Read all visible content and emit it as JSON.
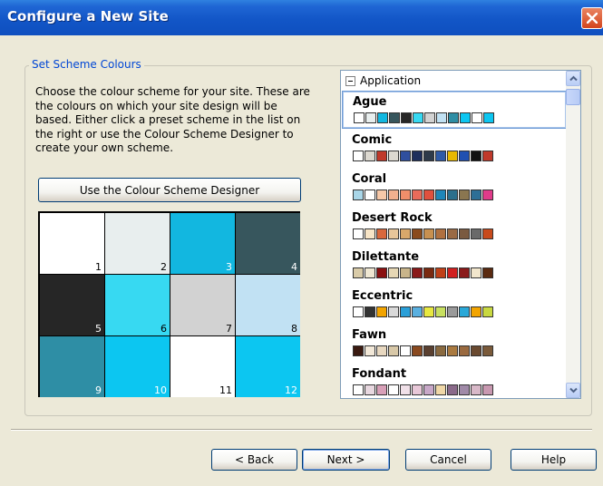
{
  "window": {
    "title": "Configure a New Site"
  },
  "group": {
    "legend": "Set Scheme Colours"
  },
  "description": "Choose the colour scheme for your site. These are the colours on which your site design will be based. Either click a preset scheme in the list on the right or use the Colour Scheme Designer to create your own scheme.",
  "designer_button": "Use the Colour Scheme Designer",
  "palette": [
    {
      "num": "1",
      "color": "#ffffff",
      "text_color": "#000000"
    },
    {
      "num": "2",
      "color": "#e8eeee",
      "text_color": "#000000"
    },
    {
      "num": "3",
      "color": "#12b7e0",
      "text_color": "#ffffff"
    },
    {
      "num": "4",
      "color": "#37565d",
      "text_color": "#ffffff"
    },
    {
      "num": "5",
      "color": "#262626",
      "text_color": "#ffffff"
    },
    {
      "num": "6",
      "color": "#37d9f2",
      "text_color": "#000000"
    },
    {
      "num": "7",
      "color": "#d2d2d2",
      "text_color": "#000000"
    },
    {
      "num": "8",
      "color": "#c1e1f3",
      "text_color": "#000000"
    },
    {
      "num": "9",
      "color": "#2e8ea5",
      "text_color": "#ffffff"
    },
    {
      "num": "10",
      "color": "#0cc6f1",
      "text_color": "#ffffff"
    },
    {
      "num": "11",
      "color": "#ffffff",
      "text_color": "#000000"
    },
    {
      "num": "12",
      "color": "#0cc6f1",
      "text_color": "#ffffff"
    }
  ],
  "list": {
    "group_label": "Application",
    "schemes": [
      {
        "name": "Ague",
        "selected": true,
        "colors": [
          "#ffffff",
          "#e8eeee",
          "#12b7e0",
          "#37565d",
          "#262626",
          "#37d9f2",
          "#d2d2d2",
          "#c1e1f3",
          "#2e8ea5",
          "#0cc6f1",
          "#ffffff",
          "#0cc6f1"
        ]
      },
      {
        "name": "Comic",
        "selected": false,
        "colors": [
          "#ffffff",
          "#dcd8d0",
          "#c0392b",
          "#dcd8d0",
          "#2f4f9e",
          "#1f2f5c",
          "#2e3a4a",
          "#2e5aa8",
          "#e8b800",
          "#2050b0",
          "#111111",
          "#c0392b"
        ]
      },
      {
        "name": "Coral",
        "selected": false,
        "colors": [
          "#a9d6e8",
          "#ffffff",
          "#f6c8a8",
          "#f3b08f",
          "#f08e6a",
          "#e96b5a",
          "#e0503e",
          "#1f86b8",
          "#2b6f8c",
          "#8a7650",
          "#2e6f96",
          "#e03b8a"
        ]
      },
      {
        "name": "Desert Rock",
        "selected": false,
        "colors": [
          "#ffffff",
          "#f7e4c6",
          "#d9683c",
          "#e8c69a",
          "#d8a86a",
          "#8a4a1c",
          "#c89050",
          "#b07040",
          "#9a6a44",
          "#7a5a40",
          "#6a6a6a",
          "#c84a1c"
        ]
      },
      {
        "name": "Dilettante",
        "selected": false,
        "colors": [
          "#d9cba8",
          "#efe7d2",
          "#8a1010",
          "#e6d7b4",
          "#c8b48a",
          "#8a1a1a",
          "#7a2a10",
          "#c04018",
          "#d02020",
          "#8a1a1a",
          "#f2e6cc",
          "#5a2a10"
        ]
      },
      {
        "name": "Eccentric",
        "selected": false,
        "colors": [
          "#ffffff",
          "#333333",
          "#f2a400",
          "#d9d9d9",
          "#2a9fd8",
          "#5ab0e0",
          "#e8e840",
          "#c8e060",
          "#9a9a9a",
          "#2aa8d8",
          "#f2a400",
          "#c8d840"
        ]
      },
      {
        "name": "Fawn",
        "selected": false,
        "colors": [
          "#3a1a10",
          "#f2e8d8",
          "#e8d8c0",
          "#d8c8a8",
          "#ffffff",
          "#8a4a20",
          "#5a4030",
          "#8a6a40",
          "#aa7a40",
          "#9a6a40",
          "#6a4a30",
          "#7a5a3a"
        ]
      },
      {
        "name": "Fondant",
        "selected": false,
        "colors": [
          "#ffffff",
          "#e8d8e0",
          "#d8a0b8",
          "#ffffff",
          "#f0e0e8",
          "#e8c8d8",
          "#c8a8c8",
          "#f0d8a8",
          "#8a6a8a",
          "#a08aa8",
          "#d8b8c8",
          "#c898b0"
        ]
      }
    ]
  },
  "buttons": {
    "back": "< Back",
    "next": "Next >",
    "cancel": "Cancel",
    "help": "Help"
  },
  "icons": {
    "close": "close-icon",
    "collapse": "collapse-icon",
    "scroll_up": "chevron-up-icon",
    "scroll_down": "chevron-down-icon"
  }
}
